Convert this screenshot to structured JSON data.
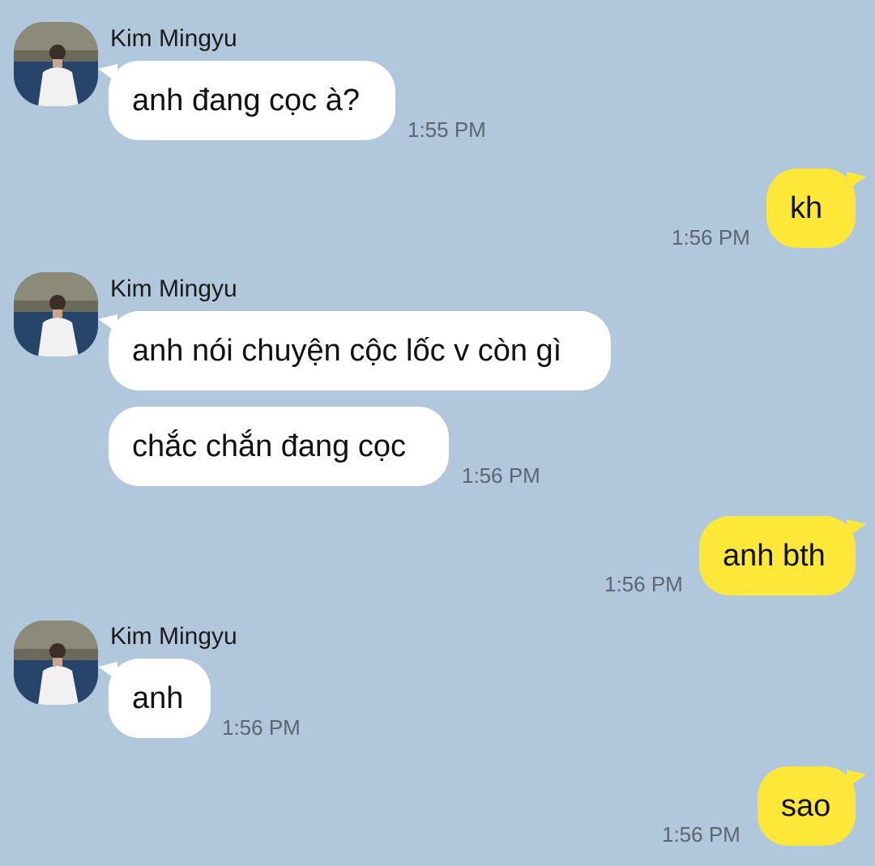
{
  "colors": {
    "background": "#b1c7dc",
    "incoming_bubble": "#ffffff",
    "outgoing_bubble": "#fde83a",
    "timestamp": "#5b6670"
  },
  "contact": {
    "name": "Kim Mingyu",
    "avatar_icon": "profile-photo"
  },
  "messages": [
    {
      "sender": "Kim Mingyu",
      "text": "anh đang cọc à?",
      "time": "1:55 PM"
    },
    {
      "sender": "me",
      "text": "kh",
      "time": "1:56 PM"
    },
    {
      "sender": "Kim Mingyu",
      "text": "anh nói chuyện cộc lốc v còn gì",
      "time": ""
    },
    {
      "sender": "Kim Mingyu",
      "text": "chắc chắn đang cọc",
      "time": "1:56 PM"
    },
    {
      "sender": "me",
      "text": "anh bth",
      "time": "1:56 PM"
    },
    {
      "sender": "Kim Mingyu",
      "text": "anh",
      "time": "1:56 PM"
    },
    {
      "sender": "me",
      "text": "sao",
      "time": "1:56 PM"
    }
  ]
}
